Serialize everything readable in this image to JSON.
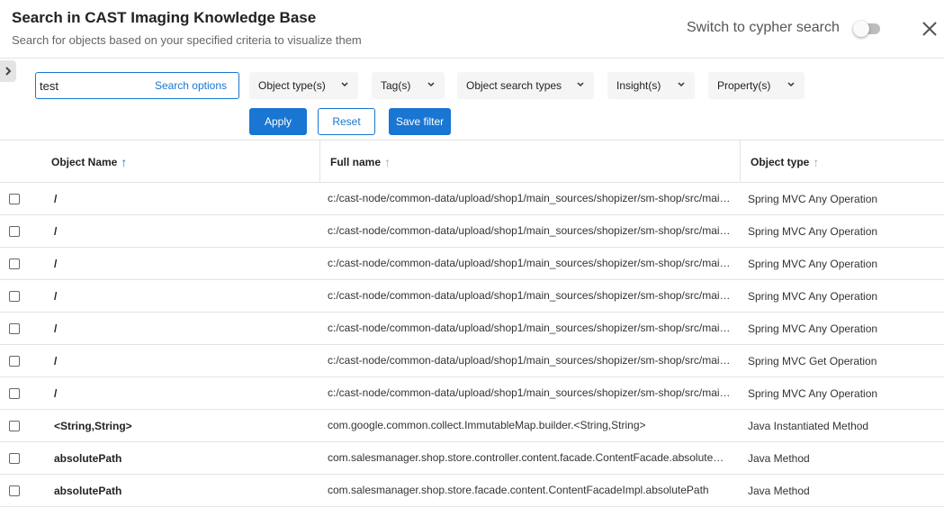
{
  "header": {
    "title": "Search in CAST Imaging Knowledge Base",
    "subtitle": "Search for objects based on your specified criteria to visualize them",
    "switch_label": "Switch to cypher search"
  },
  "search": {
    "value": "test",
    "options_label": "Search options"
  },
  "filters": [
    {
      "label": "Object type(s)"
    },
    {
      "label": "Tag(s)"
    },
    {
      "label": "Object search types"
    },
    {
      "label": "Insight(s)"
    },
    {
      "label": "Property(s)"
    }
  ],
  "actions": {
    "apply_label": "Apply",
    "reset_label": "Reset",
    "save_label": "Save filter"
  },
  "table": {
    "columns": [
      {
        "label": "Object Name",
        "sort": "↑"
      },
      {
        "label": "Full name",
        "sort": "↑"
      },
      {
        "label": "Object type",
        "sort": "↑"
      }
    ],
    "rows": [
      {
        "name": "/",
        "full": "c:/cast-node/common-data/upload/shop1/main_sources/shopizer/sm-shop/src/main/java/com/salesmanager/shop",
        "type": "Spring MVC Any Operation"
      },
      {
        "name": "/",
        "full": "c:/cast-node/common-data/upload/shop1/main_sources/shopizer/sm-shop/src/main/java/com/salesmanager/shop",
        "type": "Spring MVC Any Operation"
      },
      {
        "name": "/",
        "full": "c:/cast-node/common-data/upload/shop1/main_sources/shopizer/sm-shop/src/main/java/com/salesmanager/shop",
        "type": "Spring MVC Any Operation"
      },
      {
        "name": "/",
        "full": "c:/cast-node/common-data/upload/shop1/main_sources/shopizer/sm-shop/src/main/java/com/salesmanager/shop",
        "type": "Spring MVC Any Operation"
      },
      {
        "name": "/",
        "full": "c:/cast-node/common-data/upload/shop1/main_sources/shopizer/sm-shop/src/main/java/com/salesmanager/shop",
        "type": "Spring MVC Any Operation"
      },
      {
        "name": "/",
        "full": "c:/cast-node/common-data/upload/shop1/main_sources/shopizer/sm-shop/src/main/java/com/salesmanager/shop",
        "type": "Spring MVC Get Operation"
      },
      {
        "name": "/",
        "full": "c:/cast-node/common-data/upload/shop1/main_sources/shopizer/sm-shop/src/main/java/com/salesmanager/shop",
        "type": "Spring MVC Any Operation"
      },
      {
        "name": "<String,String>",
        "full": "com.google.common.collect.ImmutableMap.builder.<String,String>",
        "type": "Java Instantiated Method"
      },
      {
        "name": "absolutePath",
        "full": "com.salesmanager.shop.store.controller.content.facade.ContentFacade.absolutePath",
        "type": "Java Method"
      },
      {
        "name": "absolutePath",
        "full": "com.salesmanager.shop.store.facade.content.ContentFacadeImpl.absolutePath",
        "type": "Java Method"
      }
    ]
  },
  "colors": {
    "accent": "#1976d2",
    "border": "#e3e3e3",
    "filter_bg": "#f5f5f5"
  }
}
